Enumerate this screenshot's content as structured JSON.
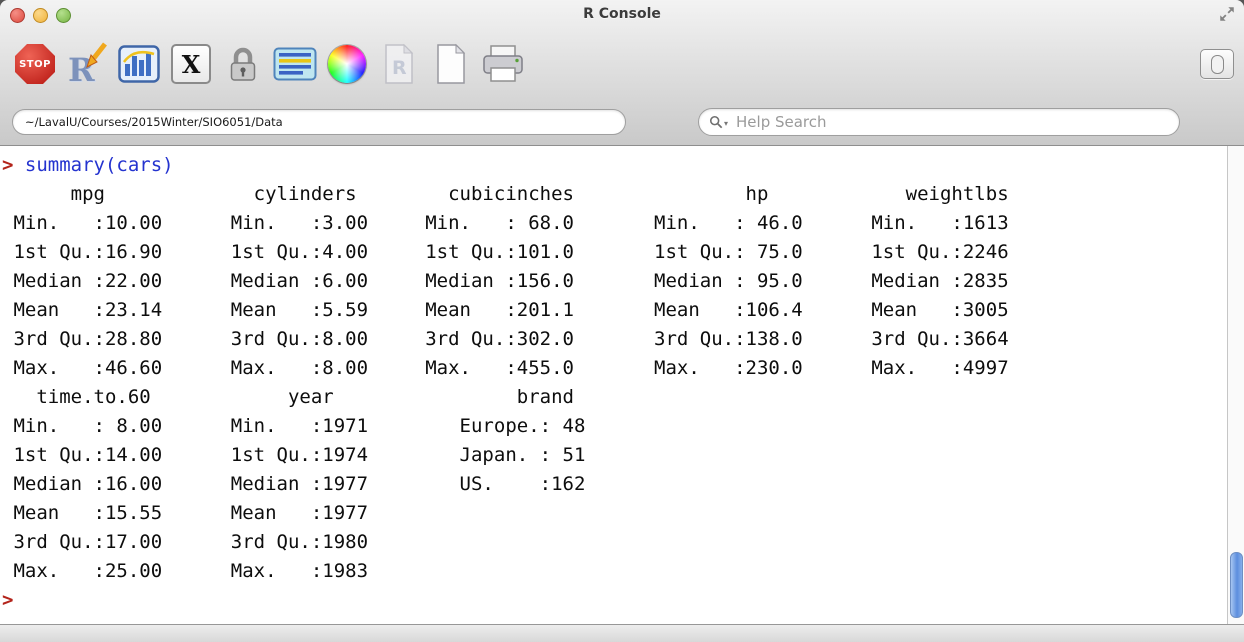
{
  "window": {
    "title": "R Console"
  },
  "toolbar": {
    "stop_label": "STOP",
    "r_label": "R",
    "x11_label": "X",
    "source_label": "R"
  },
  "pathbar": {
    "working_directory": "~/LavalU/Courses/2015Winter/SIO6051/Data",
    "search_placeholder": "Help Search"
  },
  "console": {
    "prompt": "> ",
    "command": "summary(cars)",
    "output": "      mpg             cylinders        cubicinches               hp            weightlbs\n Min.   :10.00      Min.   :3.00     Min.   : 68.0       Min.   : 46.0      Min.   :1613\n 1st Qu.:16.90      1st Qu.:4.00     1st Qu.:101.0       1st Qu.: 75.0      1st Qu.:2246\n Median :22.00      Median :6.00     Median :156.0       Median : 95.0      Median :2835\n Mean   :23.14      Mean   :5.59     Mean   :201.1       Mean   :106.4      Mean   :3005\n 3rd Qu.:28.80      3rd Qu.:8.00     3rd Qu.:302.0       3rd Qu.:138.0      3rd Qu.:3664\n Max.   :46.60      Max.   :8.00     Max.   :455.0       Max.   :230.0      Max.   :4997\n   time.to.60            year                brand\n Min.   : 8.00      Min.   :1971        Europe.: 48\n 1st Qu.:14.00      1st Qu.:1974        Japan. : 51\n Median :16.00      Median :1977        US.    :162\n Mean   :15.55      Mean   :1977\n 3rd Qu.:17.00      3rd Qu.:1980\n Max.   :25.00      Max.   :1983",
    "trailing_prompt": ">"
  }
}
